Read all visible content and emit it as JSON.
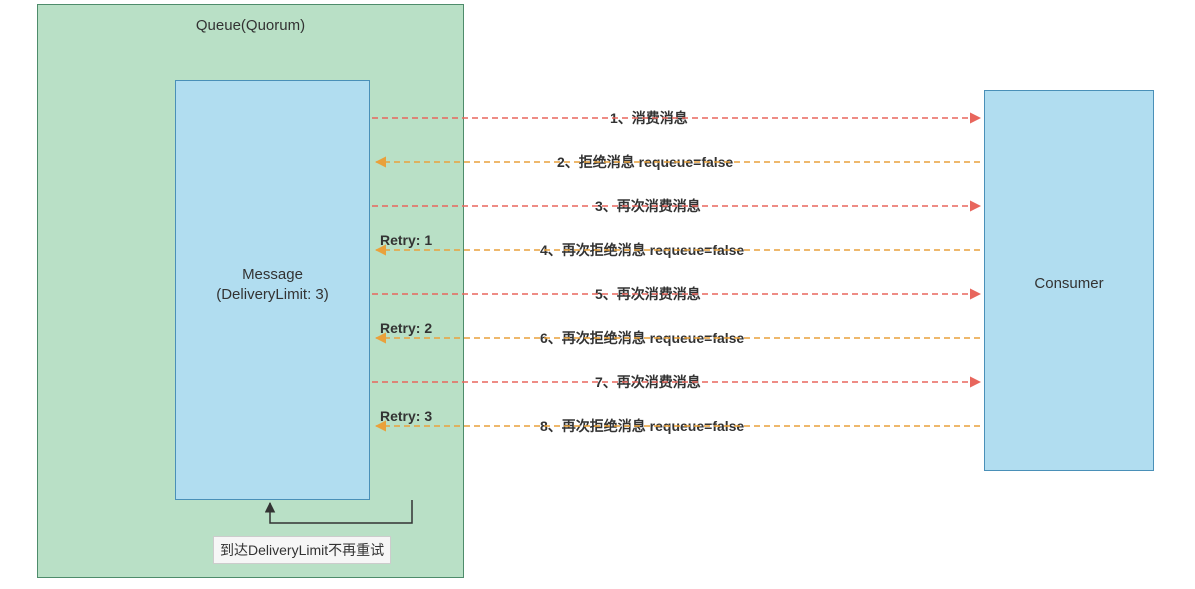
{
  "queue": {
    "title": "Queue(Quorum)"
  },
  "message": {
    "line1": "Message",
    "line2": "(DeliveryLimit: 3)"
  },
  "consumer": {
    "label": "Consumer"
  },
  "note": {
    "text": "到达DeliveryLimit不再重试"
  },
  "retry": {
    "r1": "Retry: 1",
    "r2": "Retry: 2",
    "r3": "Retry: 3"
  },
  "steps": {
    "s1": "1、消费消息",
    "s2": "2、拒绝消息 requeue=false",
    "s3": "3、再次消费消息",
    "s4": "4、再次拒绝消息 requeue=false",
    "s5": "5、再次消费消息",
    "s6": "6、再次拒绝消息 requeue=false",
    "s7": "7、再次消费消息",
    "s8": "8、再次拒绝消息 requeue=false"
  },
  "colors": {
    "queue_fill": "#B9E0C6",
    "message_fill": "#B1DDF0",
    "consumer_fill": "#B1DDF0",
    "arrow_red": "#E8665D",
    "arrow_orange": "#E9A13B"
  }
}
